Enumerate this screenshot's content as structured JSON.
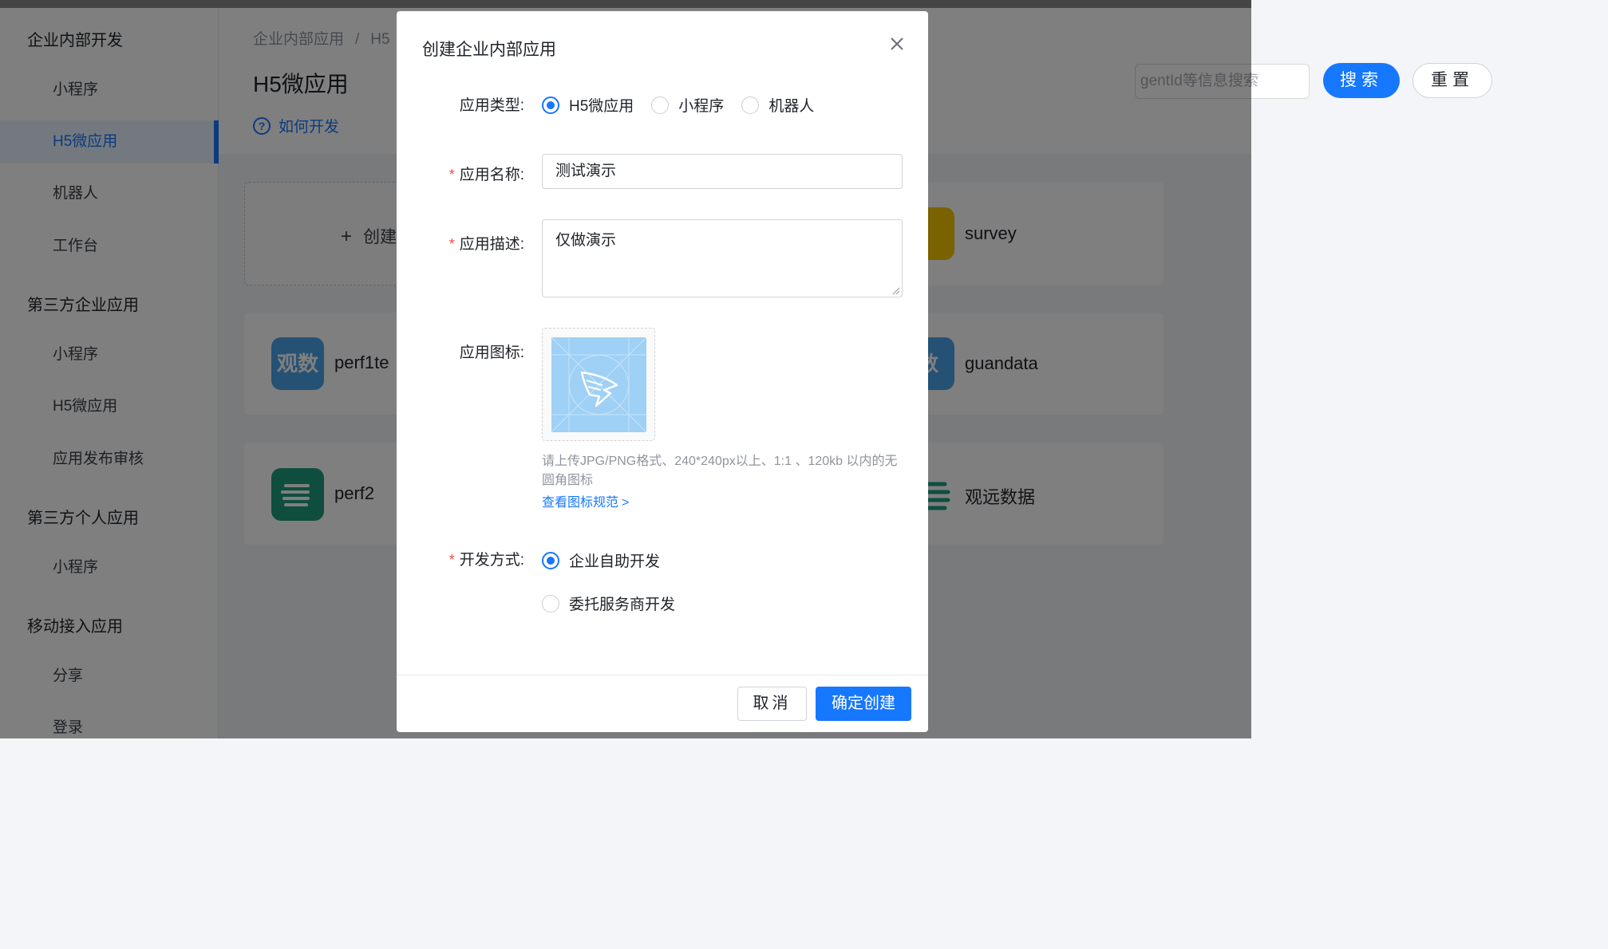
{
  "sidebar": {
    "groups": [
      {
        "title": "企业内部开发",
        "items": [
          "小程序",
          "H5微应用",
          "机器人",
          "工作台"
        ]
      },
      {
        "title": "第三方企业应用",
        "items": [
          "小程序",
          "H5微应用",
          "应用发布审核"
        ]
      },
      {
        "title": "第三方个人应用",
        "items": [
          "小程序"
        ]
      },
      {
        "title": "移动接入应用",
        "items": [
          "分享",
          "登录"
        ]
      }
    ],
    "active_item": "H5微应用"
  },
  "header": {
    "breadcrumb": [
      "企业内部应用",
      "H5"
    ],
    "page_title": "H5微应用",
    "howto_link": "如何开发",
    "search_placeholder": "gentId等信息搜索",
    "search_button": "搜索",
    "reset_button": "重置"
  },
  "cards": {
    "create_label": "创建",
    "apps": [
      {
        "name": "perf1te",
        "icon_text": "观数",
        "icon_color": "#2d8cf0"
      },
      {
        "name": "perf2",
        "icon_text": "",
        "icon_color": "#19b394"
      },
      {
        "name": "survey",
        "icon_text": "",
        "icon_color": "#f5c400"
      },
      {
        "name": "guandata",
        "icon_text": "数",
        "icon_color": "#2d8cf0"
      },
      {
        "name": "观远数据",
        "icon_text": "",
        "icon_color": "#19b394"
      }
    ]
  },
  "modal": {
    "title": "创建企业内部应用",
    "app_type": {
      "label": "应用类型:",
      "options": [
        "H5微应用",
        "小程序",
        "机器人"
      ],
      "selected": "H5微应用"
    },
    "app_name": {
      "label": "应用名称:",
      "value": "测试演示"
    },
    "app_desc": {
      "label": "应用描述:",
      "value": "仅做演示"
    },
    "app_icon": {
      "label": "应用图标:",
      "hint": "请上传JPG/PNG格式、240*240px以上、1:1 、120kb 以内的无圆角图标",
      "spec_link": "查看图标规范"
    },
    "dev_mode": {
      "label": "开发方式:",
      "options": [
        "企业自助开发",
        "委托服务商开发"
      ],
      "selected": "企业自助开发"
    },
    "cancel_button": "取消",
    "confirm_button": "确定创建"
  },
  "colors": {
    "accent": "#1677ff",
    "required": "#f54a45"
  }
}
